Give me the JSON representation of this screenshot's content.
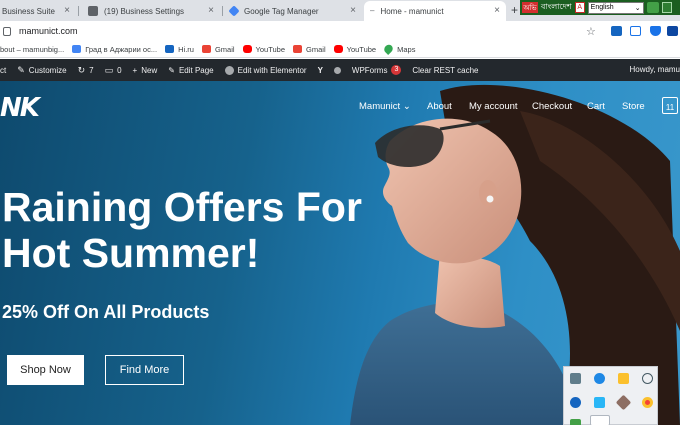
{
  "browser": {
    "tabs": [
      {
        "title": "Business Suite",
        "active": false
      },
      {
        "title": "(19) Business Settings",
        "active": false
      },
      {
        "title": "Google Tag Manager",
        "active": false
      },
      {
        "title": "Home - mamunict",
        "active": true
      }
    ],
    "new_tab_label": "+",
    "address": "mamunict.com",
    "extension": {
      "red_label": "অভি",
      "script_label": "বাংলাদেশ",
      "language_value": "English"
    },
    "bookmarks": [
      {
        "label": "bout – mamunbig...",
        "icon_color": "#1a73e8"
      },
      {
        "label": "Град в Аджарии ос...",
        "icon_color": "#4285f4"
      },
      {
        "label": "Hi.ru",
        "icon_color": "#1565c0"
      },
      {
        "label": "Gmail",
        "icon_color": "#ea4335"
      },
      {
        "label": "YouTube",
        "icon_color": "#ff0000"
      },
      {
        "label": "Gmail",
        "icon_color": "#ea4335"
      },
      {
        "label": "YouTube",
        "icon_color": "#ff0000"
      },
      {
        "label": "Maps",
        "icon_color": "#34a853"
      }
    ]
  },
  "adminbar": {
    "site_fragment": "ct",
    "customize": "Customize",
    "updates_count": "7",
    "comments_count": "0",
    "new_label": "New",
    "edit_page": "Edit Page",
    "edit_elementor": "Edit with Elementor",
    "wpforms": "WPForms",
    "wpforms_badge": "3",
    "clear_cache": "Clear REST cache",
    "howdy": "Howdy, mamu"
  },
  "site": {
    "logo": "NK",
    "nav": {
      "site_menu": "Mamunict",
      "about": "About",
      "my_account": "My account",
      "checkout": "Checkout",
      "cart": "Cart",
      "store": "Store",
      "cart_count": "11"
    },
    "hero": {
      "headline": "Raining Offers For Hot Summer!",
      "subline": "25% Off On All Products",
      "primary_button": "Shop Now",
      "secondary_button": "Find More"
    }
  },
  "colors": {
    "admin_bar": "#23282d",
    "hero_blue": "#16628c",
    "badge_red": "#d63638"
  }
}
